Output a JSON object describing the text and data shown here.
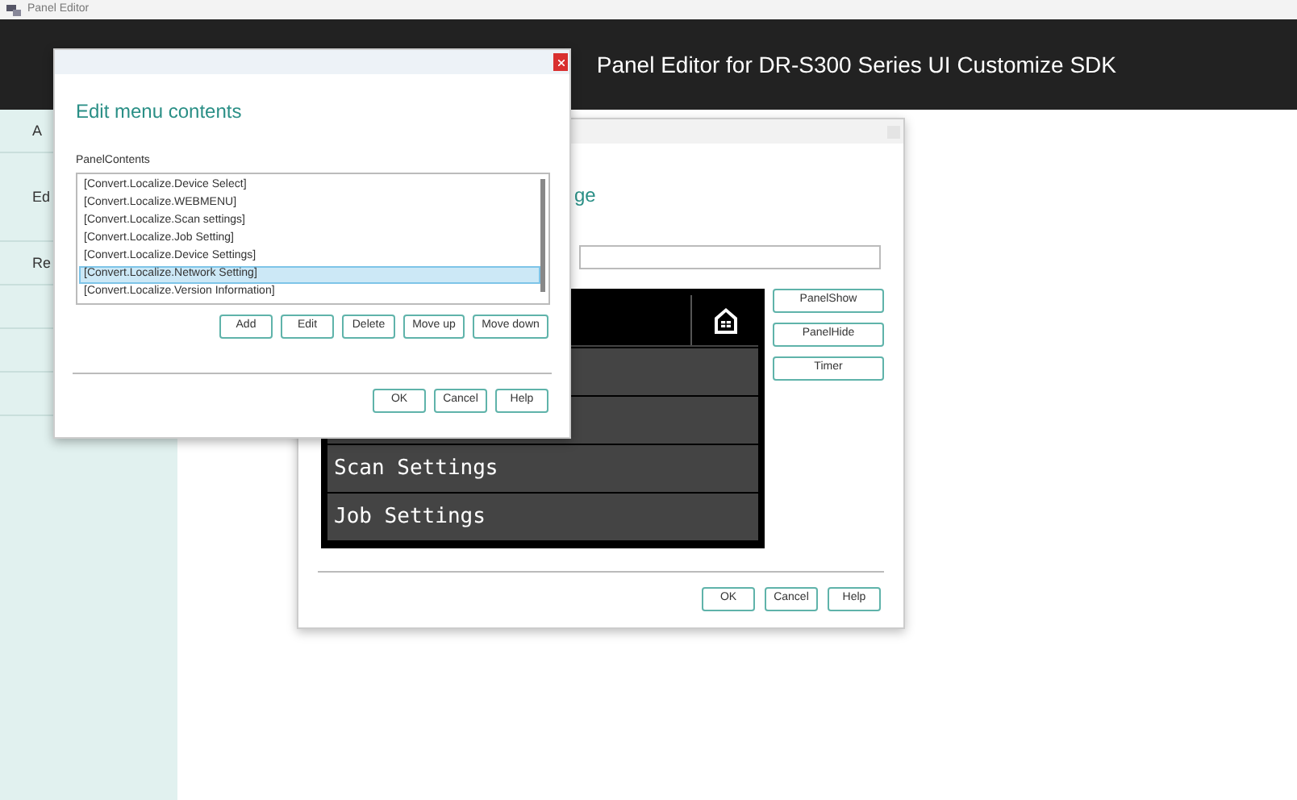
{
  "app_title": "Panel Editor",
  "header_title": "Panel Editor for DR-S300 Series UI Customize SDK",
  "sidebar": {
    "items": [
      {
        "label": "A"
      },
      {
        "label": "Ed"
      },
      {
        "label": "Re"
      }
    ]
  },
  "back_dialog": {
    "heading": "ge",
    "panel_rows": [
      {
        "label": "Scan Settings"
      },
      {
        "label": "Job Settings"
      }
    ],
    "side_buttons": [
      "PanelShow",
      "PanelHide",
      "Timer"
    ],
    "buttons": [
      "OK",
      "Cancel",
      "Help"
    ]
  },
  "front_dialog": {
    "heading": "Edit menu contents",
    "list_label": "PanelContents",
    "items": [
      {
        "label": "[Convert.Localize.Device Select]",
        "selected": false
      },
      {
        "label": "[Convert.Localize.WEBMENU]",
        "selected": false
      },
      {
        "label": "[Convert.Localize.Scan settings]",
        "selected": false
      },
      {
        "label": "[Convert.Localize.Job Setting]",
        "selected": false
      },
      {
        "label": "[Convert.Localize.Device Settings]",
        "selected": false
      },
      {
        "label": "[Convert.Localize.Network Setting]",
        "selected": true
      },
      {
        "label": "[Convert.Localize.Version Information]",
        "selected": false
      }
    ],
    "list_buttons": [
      "Add",
      "Edit",
      "Delete",
      "Move up",
      "Move down"
    ],
    "buttons": [
      "OK",
      "Cancel",
      "Help"
    ]
  }
}
